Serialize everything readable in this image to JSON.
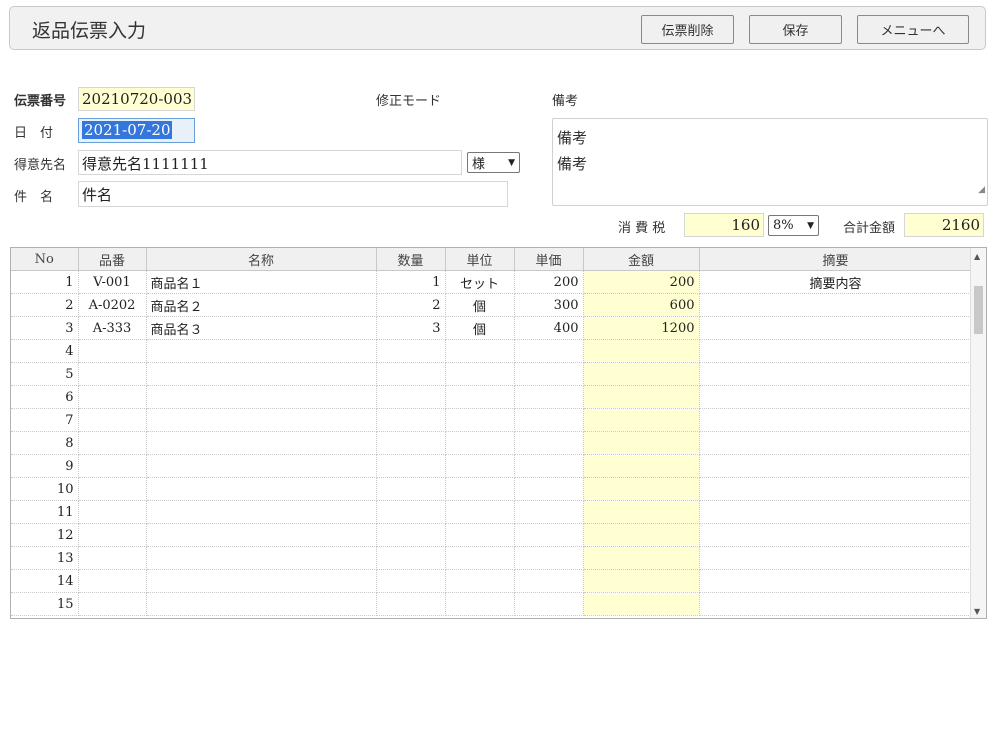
{
  "header": {
    "title": "返品伝票入力",
    "buttons": {
      "delete": "伝票削除",
      "save": "保存",
      "menu": "メニューへ"
    }
  },
  "form": {
    "slip_no_label": "伝票番号",
    "slip_no": "20210720-003",
    "mode_text": "修正モード",
    "remarks_label": "備考",
    "date_label": "日　付",
    "date": "2021-07-20",
    "customer_label": "得意先名",
    "customer": "得意先名1111111",
    "honorific": "様",
    "subject_label": "件　名",
    "subject": "件名",
    "remarks_line1": "備考",
    "remarks_line2": "備考"
  },
  "totals": {
    "tax_label": "消 費 税",
    "tax": "160",
    "tax_rate": "8%",
    "total_label": "合計金額",
    "total": "2160"
  },
  "grid": {
    "columns": [
      "No",
      "品番",
      "名称",
      "数量",
      "単位",
      "単価",
      "金額",
      "摘要"
    ],
    "rows": [
      {
        "no": "1",
        "code": "V-001",
        "name": "商品名１",
        "qty": "1",
        "unit": "セット",
        "price": "200",
        "amount": "200",
        "note": "摘要内容"
      },
      {
        "no": "2",
        "code": "A-0202",
        "name": "商品名２",
        "qty": "2",
        "unit": "個",
        "price": "300",
        "amount": "600",
        "note": ""
      },
      {
        "no": "3",
        "code": "A-333",
        "name": "商品名３",
        "qty": "3",
        "unit": "個",
        "price": "400",
        "amount": "1200",
        "note": ""
      },
      {
        "no": "4",
        "code": "",
        "name": "",
        "qty": "",
        "unit": "",
        "price": "",
        "amount": "",
        "note": ""
      },
      {
        "no": "5",
        "code": "",
        "name": "",
        "qty": "",
        "unit": "",
        "price": "",
        "amount": "",
        "note": ""
      },
      {
        "no": "6",
        "code": "",
        "name": "",
        "qty": "",
        "unit": "",
        "price": "",
        "amount": "",
        "note": ""
      },
      {
        "no": "7",
        "code": "",
        "name": "",
        "qty": "",
        "unit": "",
        "price": "",
        "amount": "",
        "note": ""
      },
      {
        "no": "8",
        "code": "",
        "name": "",
        "qty": "",
        "unit": "",
        "price": "",
        "amount": "",
        "note": ""
      },
      {
        "no": "9",
        "code": "",
        "name": "",
        "qty": "",
        "unit": "",
        "price": "",
        "amount": "",
        "note": ""
      },
      {
        "no": "10",
        "code": "",
        "name": "",
        "qty": "",
        "unit": "",
        "price": "",
        "amount": "",
        "note": ""
      },
      {
        "no": "11",
        "code": "",
        "name": "",
        "qty": "",
        "unit": "",
        "price": "",
        "amount": "",
        "note": ""
      },
      {
        "no": "12",
        "code": "",
        "name": "",
        "qty": "",
        "unit": "",
        "price": "",
        "amount": "",
        "note": ""
      },
      {
        "no": "13",
        "code": "",
        "name": "",
        "qty": "",
        "unit": "",
        "price": "",
        "amount": "",
        "note": ""
      },
      {
        "no": "14",
        "code": "",
        "name": "",
        "qty": "",
        "unit": "",
        "price": "",
        "amount": "",
        "note": ""
      },
      {
        "no": "15",
        "code": "",
        "name": "",
        "qty": "",
        "unit": "",
        "price": "",
        "amount": "",
        "note": ""
      }
    ]
  },
  "colors": {
    "yellow_field": "#ffffd2",
    "selection": "#3377dd"
  },
  "icons": {
    "select": "chevron-down-icon",
    "resize": "resize-grip-icon",
    "scroll_up": "scroll-up-icon",
    "scroll_down": "scroll-down-icon"
  }
}
